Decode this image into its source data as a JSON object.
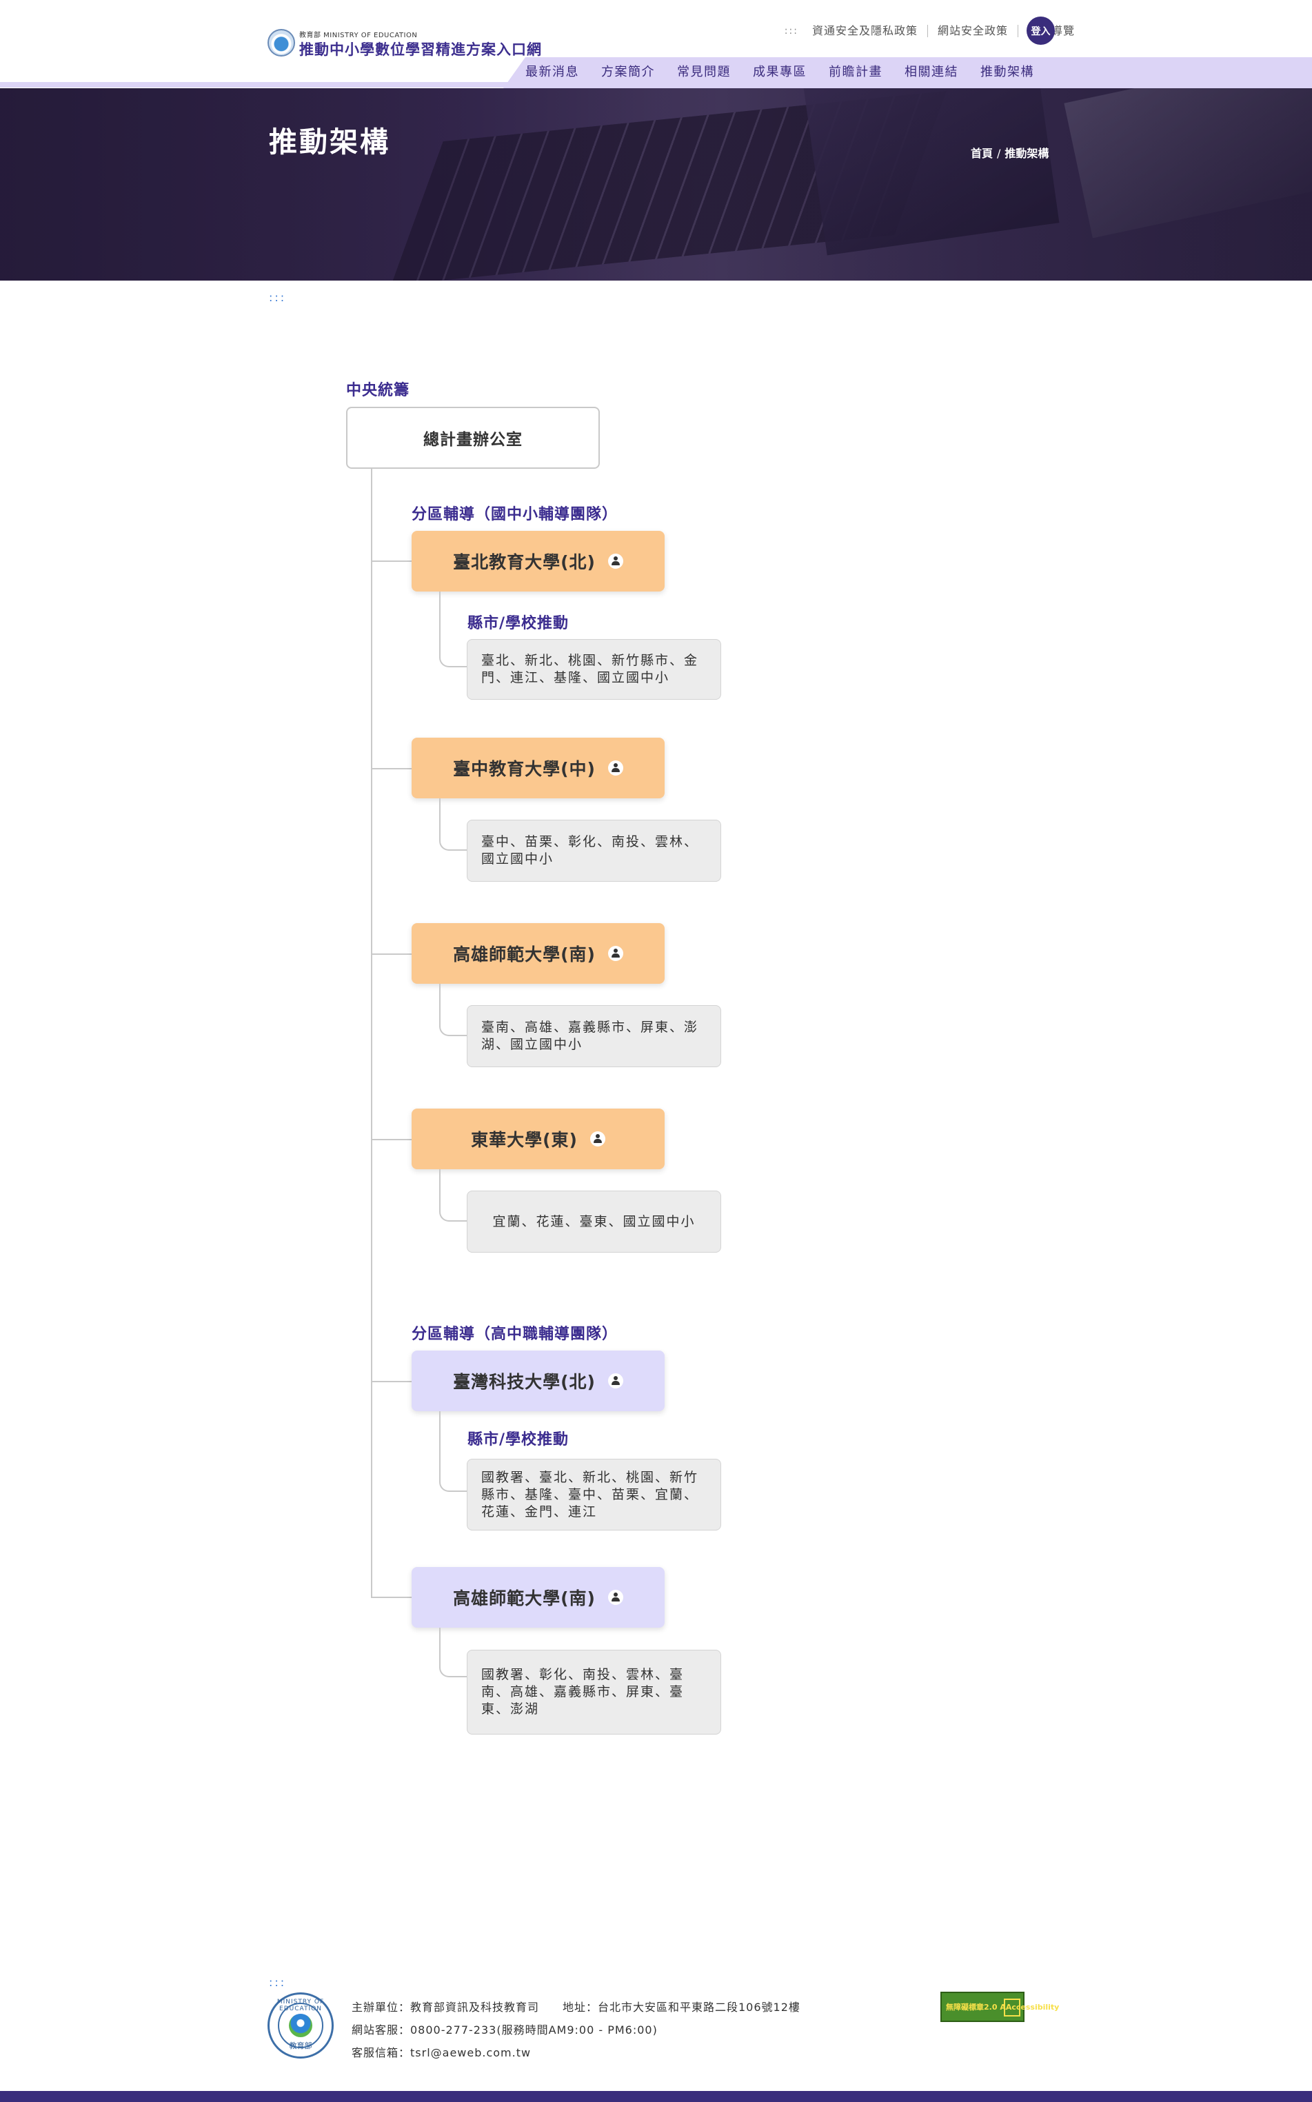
{
  "header": {
    "agency_label": "教育部 MINISTRY OF EDUCATION",
    "site_title": "推動中小學數位學習精進方案入口網",
    "top_accesskey": ":::",
    "top_links": [
      "資通安全及隱私政策",
      "網站安全政策",
      "網站導覽"
    ],
    "login_label": "登入",
    "main_nav": [
      "最新消息",
      "方案簡介",
      "常見問題",
      "成果專區",
      "前瞻計畫",
      "相關連結",
      "推動架構"
    ]
  },
  "banner": {
    "title": "推動架構",
    "breadcrumb": [
      "首頁",
      "推動架構"
    ],
    "breadcrumb_sep": "/"
  },
  "content_accesskey": ":::",
  "org": {
    "central_label": "中央統籌",
    "hq_label": "總計畫辦公室",
    "groups": [
      {
        "label": "分區輔導（國中小輔導團隊）",
        "units": [
          {
            "name": "臺北教育大學(北)",
            "sub_label": "縣市/學校推動",
            "regions": "臺北、新北、桃園、新竹縣市、金門、連江、基隆、國立國中小"
          },
          {
            "name": "臺中教育大學(中)",
            "sub_label": "",
            "regions": "臺中、苗栗、彰化、南投、雲林、國立國中小"
          },
          {
            "name": "高雄師範大學(南)",
            "sub_label": "",
            "regions": "臺南、高雄、嘉義縣市、屏東、澎湖、國立國中小"
          },
          {
            "name": "東華大學(東)",
            "sub_label": "",
            "regions": "宜蘭、花蓮、臺東、國立國中小"
          }
        ]
      },
      {
        "label": "分區輔導（高中職輔導團隊）",
        "units": [
          {
            "name": "臺灣科技大學(北)",
            "sub_label": "縣市/學校推動",
            "regions": "國教署、臺北、新北、桃園、新竹縣市、基隆、臺中、苗栗、宜蘭、花蓮、金門、連江"
          },
          {
            "name": "高雄師範大學(南)",
            "sub_label": "",
            "regions": "國教署、彰化、南投、雲林、臺南、高雄、嘉義縣市、屏東、臺東、澎湖"
          }
        ]
      }
    ],
    "colors": {
      "k12_unit": "#fbc88f",
      "senior_unit": "#dedbfb",
      "label": "#3b2c8f"
    }
  },
  "footer": {
    "accesskey": ":::",
    "emblem_top_text": "MINISTRY OF EDUCATION",
    "emblem_bottom_text": "教育部",
    "line1": "主辦單位：教育部資訊及科技教育司　　地址：台北市大安區和平東路二段106號12樓",
    "line2": "網站客服：0800-277-233(服務時間AM9:00 - PM6:00)",
    "line3": "客服信箱：tsrl@aeweb.com.tw",
    "accessibility_badge": "無障礙標章2.0 AAccessibility"
  },
  "theme": {
    "brand": "#3a2d7c",
    "nav_band": "#dcd4f6",
    "link_blue": "#3b7bd4"
  }
}
